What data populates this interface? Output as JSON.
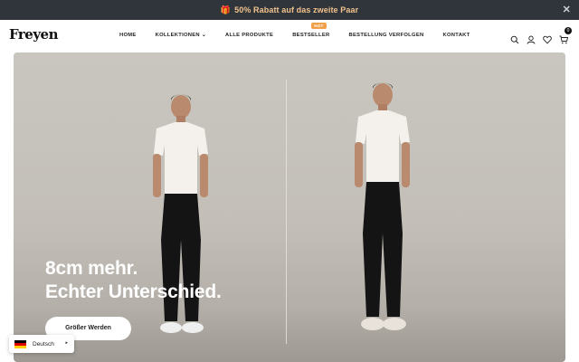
{
  "announcement": {
    "text": "50% Rabatt auf das zweite Paar",
    "gift_icon": "gift-icon",
    "close_label": "✕"
  },
  "header": {
    "logo": "Freyen",
    "menu": [
      {
        "label": "HOME"
      },
      {
        "label": "KOLLEKTIONEN ⌄"
      },
      {
        "label": "ALLE PRODUKTE"
      },
      {
        "label": "BESTSELLER",
        "badge": "HOT"
      },
      {
        "label": "BESTELLUNG VERFOLGEN"
      },
      {
        "label": "KONTAKT"
      }
    ],
    "icons": [
      "search-icon",
      "account-icon",
      "wishlist-icon",
      "cart-icon"
    ],
    "cart_count": "0"
  },
  "hero": {
    "headline_line1": "8cm mehr.",
    "headline_line2": "Echter Unterschied.",
    "cta_label": "Größer Werden"
  },
  "language": {
    "label": "Deutsch",
    "flag_colors": [
      "#000000",
      "#dd0000",
      "#ffce00"
    ]
  }
}
